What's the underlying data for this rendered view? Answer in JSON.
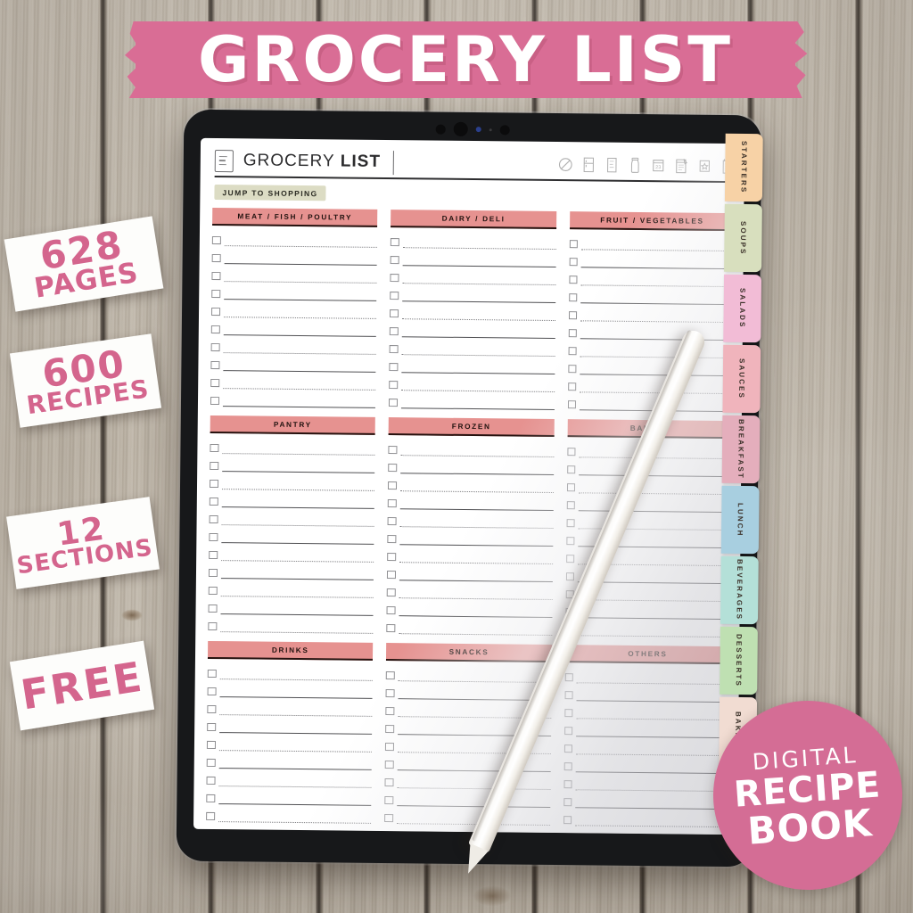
{
  "banner": {
    "title": "GROCERY LIST",
    "color": "#d96d95"
  },
  "info_cards": [
    {
      "name": "pages",
      "line1": "628",
      "line2": "PAGES"
    },
    {
      "name": "recipes",
      "line1": "600",
      "line2": "RECIPES"
    },
    {
      "name": "sections",
      "line1": "12",
      "line2": "SECTIONS"
    },
    {
      "name": "free",
      "line1": "FREE",
      "line2": ""
    }
  ],
  "page": {
    "title_light": "GROCERY",
    "title_bold": "LIST",
    "jump_button": "JUMP TO SHOPPING",
    "header_icons": [
      "no-entry-icon",
      "fridge-icon",
      "notes-icon",
      "jar-icon",
      "calendar-23-icon",
      "recipe-card-icon",
      "star-box-icon",
      "notepad-icon"
    ],
    "calendar_day": "23"
  },
  "sections": [
    {
      "title": "MEAT / FISH / POULTRY",
      "rows": 10
    },
    {
      "title": "DAIRY / DELI",
      "rows": 10
    },
    {
      "title": "FRUIT / VEGETABLES",
      "rows": 10
    },
    {
      "title": "PANTRY",
      "rows": 11
    },
    {
      "title": "FROZEN",
      "rows": 11
    },
    {
      "title": "BAKERY",
      "rows": 11
    },
    {
      "title": "DRINKS",
      "rows": 11
    },
    {
      "title": "SNACKS",
      "rows": 11
    },
    {
      "title": "OTHERS",
      "rows": 11
    }
  ],
  "section_header_color": "#e69290",
  "tabs": [
    {
      "label": "STARTERS",
      "color": "#f7d2a6"
    },
    {
      "label": "SOUPS",
      "color": "#d8dfbe"
    },
    {
      "label": "SALADS",
      "color": "#f2bcd6"
    },
    {
      "label": "SAUCES",
      "color": "#f0b4bc"
    },
    {
      "label": "BREAKFAST",
      "color": "#e4aebc"
    },
    {
      "label": "LUNCH",
      "color": "#a8cfe0"
    },
    {
      "label": "BEVERAGES",
      "color": "#b4e0d8"
    },
    {
      "label": "DESSERTS",
      "color": "#bfe0b2"
    },
    {
      "label": "BAKING",
      "color": "#f1dcd2"
    }
  ],
  "badge": {
    "line1": "DIGITAL",
    "line2": "RECIPE",
    "line3": "BOOK",
    "color": "#d46d95"
  }
}
